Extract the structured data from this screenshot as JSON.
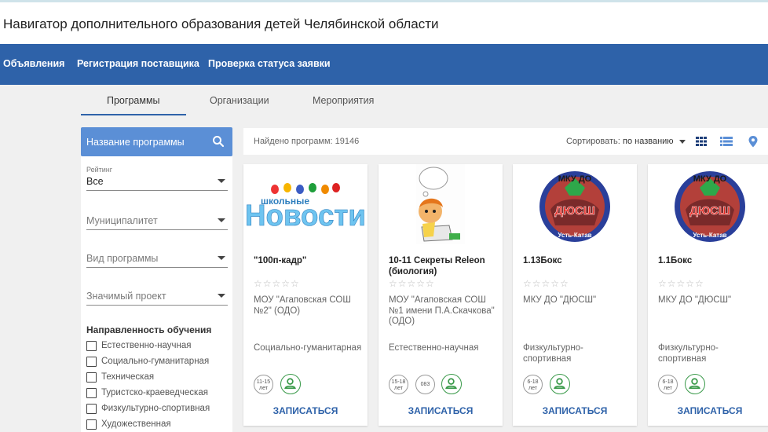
{
  "header": {
    "title": "Навигатор дополнительного образования детей Челябинской области"
  },
  "nav": {
    "items": [
      {
        "label": "Объявления"
      },
      {
        "label": "Регистрация поставщика"
      },
      {
        "label": "Проверка статуса заявки"
      }
    ]
  },
  "tabs": [
    {
      "label": "Программы",
      "active": true
    },
    {
      "label": "Организации",
      "active": false
    },
    {
      "label": "Мероприятия",
      "active": false
    }
  ],
  "search": {
    "label": "Название программы",
    "icon": "search-icon"
  },
  "filters": {
    "rating": {
      "label": "Рейтинг",
      "value": "Все"
    },
    "municipality": {
      "placeholder": "Муниципалитет"
    },
    "program_type": {
      "placeholder": "Вид программы"
    },
    "project": {
      "placeholder": "Значимый проект"
    },
    "direction": {
      "title": "Направленность обучения",
      "options": [
        {
          "label": "Естественно-научная",
          "checked": false
        },
        {
          "label": "Социально-гуманитарная",
          "checked": false
        },
        {
          "label": "Техническая",
          "checked": false
        },
        {
          "label": "Туристско-краеведческая",
          "checked": false
        },
        {
          "label": "Физкультурно-спортивная",
          "checked": false
        },
        {
          "label": "Художественная",
          "checked": false
        }
      ]
    }
  },
  "results": {
    "found": "Найдено программ: 19146",
    "sort_label": "Сортировать:",
    "sort_value": "по названию",
    "views": [
      "grid-view-icon",
      "list-view-icon",
      "map-pin-icon"
    ]
  },
  "cards": [
    {
      "image": "school-news-logo",
      "image_text_small": "школьные",
      "image_text_big": "Новости",
      "title": "\"100п-кадр\"",
      "stars": "☆☆☆☆☆",
      "org": "МОУ \"Агаповская СОШ №2\" (ОДО)",
      "direction": "Социально-гуманитарная",
      "age": "11-15",
      "age_unit": "лет",
      "code": "",
      "enroll": "ЗАПИСАТЬСЯ"
    },
    {
      "image": "boy-reading-illustration",
      "title": "10-11 Секреты Releon (биология)",
      "stars": "☆☆☆☆☆",
      "org": "МОУ \"Агаповская СОШ №1 имени П.А.Скачкова\" (ОДО)",
      "direction": "Естественно-научная",
      "age": "15-18",
      "age_unit": "лет",
      "code": "083",
      "enroll": "ЗАПИСАТЬСЯ"
    },
    {
      "image": "dyussh-emblem",
      "emblem_top": "МКУ ДО",
      "emblem_mid": "ДЮСШ",
      "emblem_bottom": "Усть-Катав",
      "title": "1.13Бокс",
      "stars": "☆☆☆☆☆",
      "org": "МКУ ДО \"ДЮСШ\"",
      "direction": "Физкультурно-спортивная",
      "age": "6-18",
      "age_unit": "лет",
      "code": "",
      "enroll": "ЗАПИСАТЬСЯ"
    },
    {
      "image": "dyussh-emblem",
      "emblem_top": "МКУ ДО",
      "emblem_mid": "ДЮСШ",
      "emblem_bottom": "Усть-Катав",
      "title": "1.1Бокс",
      "stars": "☆☆☆☆☆",
      "org": "МКУ ДО \"ДЮСШ\"",
      "direction": "Физкультурно-спортивная",
      "age": "6-18",
      "age_unit": "лет",
      "code": "",
      "enroll": "ЗАПИСАТЬСЯ"
    }
  ],
  "colors": {
    "navbar": "#2e62a9",
    "search": "#5b8fd6",
    "accent_green": "#3a9a4a"
  }
}
